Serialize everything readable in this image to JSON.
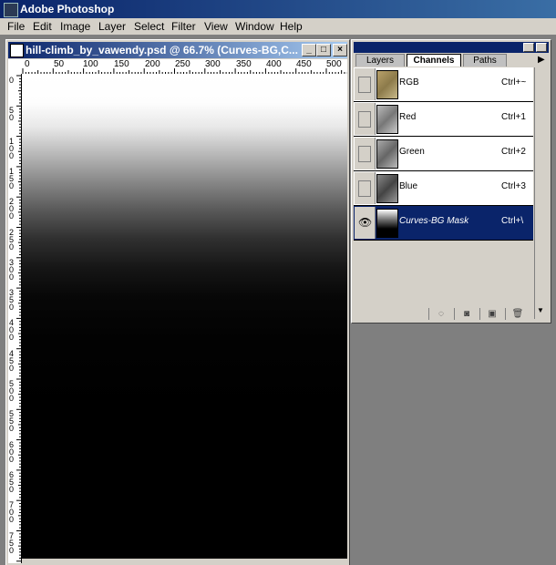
{
  "app": {
    "title": "Adobe Photoshop"
  },
  "menu": [
    "File",
    "Edit",
    "Image",
    "Layer",
    "Select",
    "Filter",
    "View",
    "Window",
    "Help"
  ],
  "document": {
    "title": "hill-climb_by_vawendy.psd @ 66.7% (Curves-BG,C...",
    "controls": {
      "minimize": "_",
      "maximize": "□",
      "close": "×"
    }
  },
  "ruler_top": [
    "0",
    "50",
    "100",
    "150",
    "200",
    "250",
    "300",
    "350",
    "400",
    "450",
    "500"
  ],
  "ruler_left": [
    "0",
    "50",
    "100",
    "150",
    "200",
    "250",
    "300",
    "350",
    "400",
    "450",
    "500",
    "550",
    "600",
    "650",
    "700",
    "750"
  ],
  "palette": {
    "tabs": [
      "Layers",
      "Channels",
      "Paths"
    ],
    "active_tab": "Channels",
    "channels": [
      {
        "name": "RGB",
        "shortcut": "Ctrl+~",
        "thumb": "rgb-photo"
      },
      {
        "name": "Red",
        "shortcut": "Ctrl+1",
        "thumb": "gray-photo"
      },
      {
        "name": "Green",
        "shortcut": "Ctrl+2",
        "thumb": "gray-photo"
      },
      {
        "name": "Blue",
        "shortcut": "Ctrl+3",
        "thumb": "dark-photo"
      },
      {
        "name": "Curves-BG Mask",
        "shortcut": "Ctrl+\\",
        "thumb": "gradient-mask",
        "selected": true,
        "visible": true
      }
    ],
    "bottom_icons": [
      "load-selection-icon",
      "save-selection-icon",
      "new-channel-icon",
      "trash-icon"
    ]
  },
  "colors": {
    "title_bar": "#0a246a",
    "selection": "#0a246a",
    "workspace": "#7f7f7f",
    "chrome": "#d4d0c8"
  }
}
